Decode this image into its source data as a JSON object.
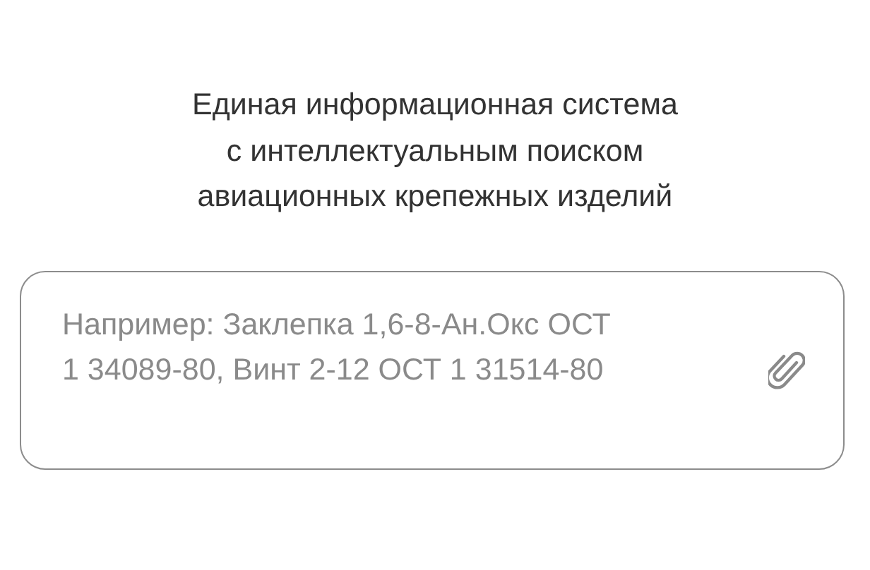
{
  "heading": [
    "Единая информационная система",
    "с интеллектуальным поиском",
    "авиационных крепежных изделий"
  ],
  "search": {
    "placeholder": "Например: Заклепка 1,6-8-Ан.Окс ОСТ 1 34089-80, Винт 2-12 ОСТ 1 31514-80"
  }
}
